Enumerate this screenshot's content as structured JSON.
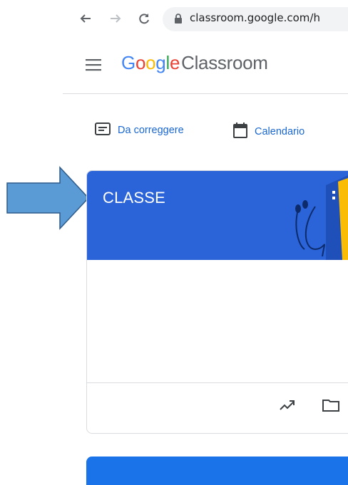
{
  "browser": {
    "url": "classroom.google.com/h",
    "icons": [
      "back-arrow-icon",
      "forward-arrow-icon",
      "reload-icon",
      "lock-icon"
    ]
  },
  "header": {
    "logo_google": "Google",
    "logo_product": "Classroom",
    "menu_icon": "hamburger-menu-icon"
  },
  "quick_links": [
    {
      "label": "Da correggere",
      "icon": "to-review-icon"
    },
    {
      "label": "Calendario",
      "icon": "calendar-icon"
    }
  ],
  "class_card": {
    "title": "CLASSE",
    "banner_color": "#2b64d8",
    "footer_icons": [
      "trending-icon",
      "folder-icon"
    ]
  },
  "annotation": {
    "arrow_color": "#5b9bd5"
  },
  "colors": {
    "link": "#1967d2",
    "google_blue": "#4285f4",
    "google_red": "#ea4335",
    "google_yellow": "#fbbc05",
    "google_green": "#34a853"
  }
}
